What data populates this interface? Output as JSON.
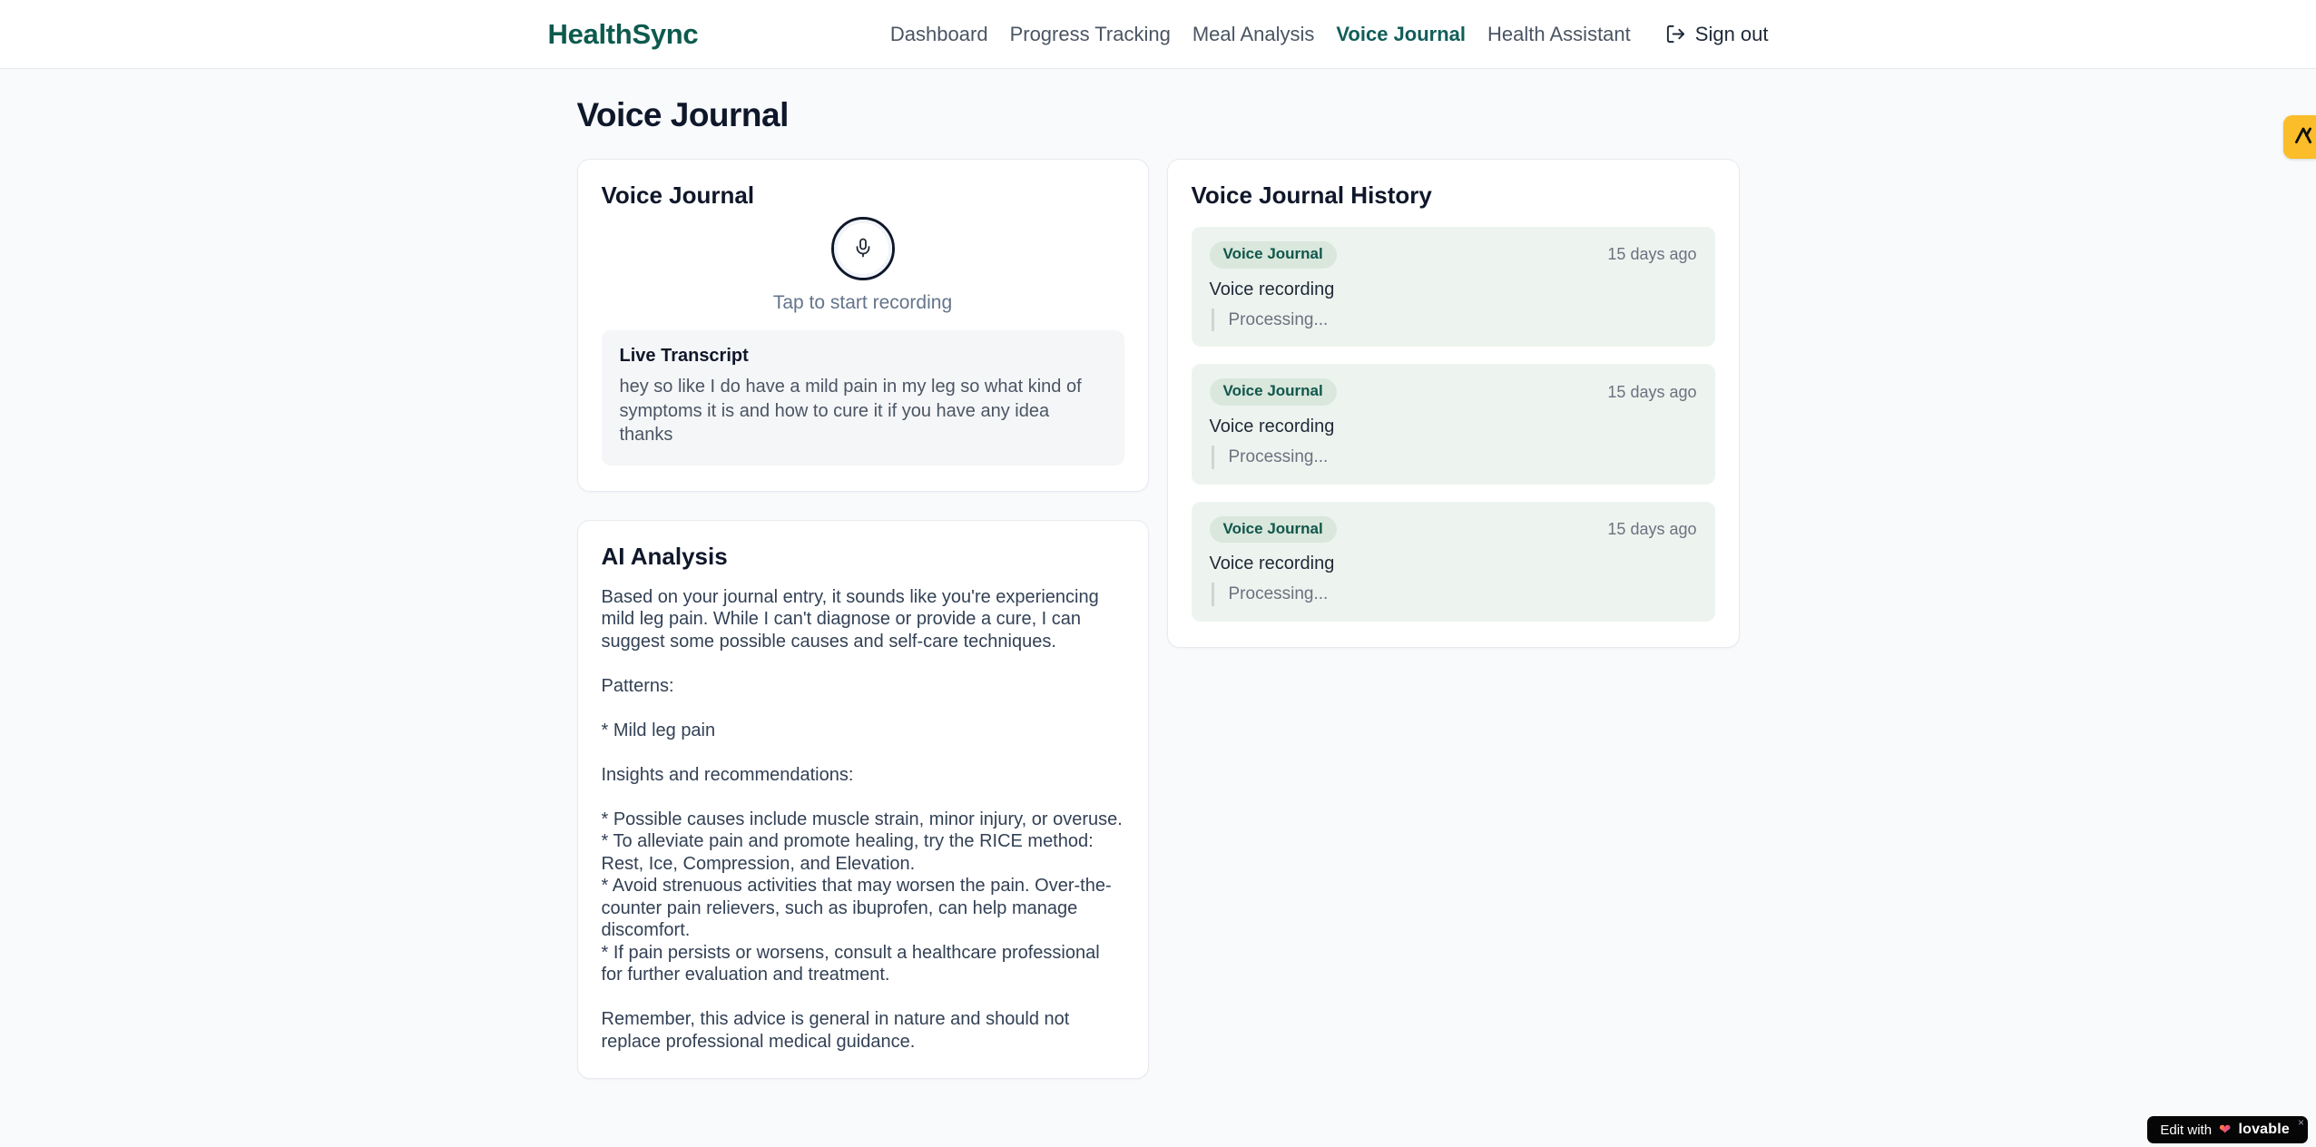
{
  "brand": {
    "name": "HealthSync"
  },
  "nav": {
    "items": [
      {
        "label": "Dashboard",
        "active": false
      },
      {
        "label": "Progress Tracking",
        "active": false
      },
      {
        "label": "Meal Analysis",
        "active": false
      },
      {
        "label": "Voice Journal",
        "active": true
      },
      {
        "label": "Health Assistant",
        "active": false
      }
    ],
    "sign_out": "Sign out"
  },
  "page": {
    "title": "Voice Journal"
  },
  "recorder": {
    "title": "Voice Journal",
    "hint": "Tap to start recording",
    "transcript_title": "Live Transcript",
    "transcript_text": "hey so like I do have a mild pain in my leg so what kind of symptoms it is and how to cure it if you have any idea thanks"
  },
  "analysis": {
    "title": "AI Analysis",
    "body": "Based on your journal entry, it sounds like you're experiencing mild leg pain. While I can't diagnose or provide a cure, I can suggest some possible causes and self-care techniques.\n\nPatterns:\n\n* Mild leg pain\n\nInsights and recommendations:\n\n* Possible causes include muscle strain, minor injury, or overuse.\n* To alleviate pain and promote healing, try the RICE method: Rest, Ice, Compression, and Elevation.\n* Avoid strenuous activities that may worsen the pain. Over-the-counter pain relievers, such as ibuprofen, can help manage discomfort.\n* If pain persists or worsens, consult a healthcare professional for further evaluation and treatment.\n\nRemember, this advice is general in nature and should not replace professional medical guidance."
  },
  "history": {
    "title": "Voice Journal History",
    "entries": [
      {
        "badge": "Voice Journal",
        "time": "15 days ago",
        "label": "Voice recording",
        "status": "Processing..."
      },
      {
        "badge": "Voice Journal",
        "time": "15 days ago",
        "label": "Voice recording",
        "status": "Processing..."
      },
      {
        "badge": "Voice Journal",
        "time": "15 days ago",
        "label": "Voice recording",
        "status": "Processing..."
      }
    ]
  },
  "overlay": {
    "edit_prefix": "Edit with",
    "edit_brand": "lovable",
    "heart": "❤",
    "close": "×"
  },
  "colors": {
    "brand_teal": "#0d5a4e",
    "active_nav": "#115e59",
    "page_bg": "#f8fafc",
    "card_border": "#e7eaee",
    "entry_bg": "#edf4ef",
    "pill_bg": "#d9e7dc",
    "pill_text": "#11564b",
    "amber_badge": "#fbbd2a",
    "muted_text": "#6b7280"
  }
}
